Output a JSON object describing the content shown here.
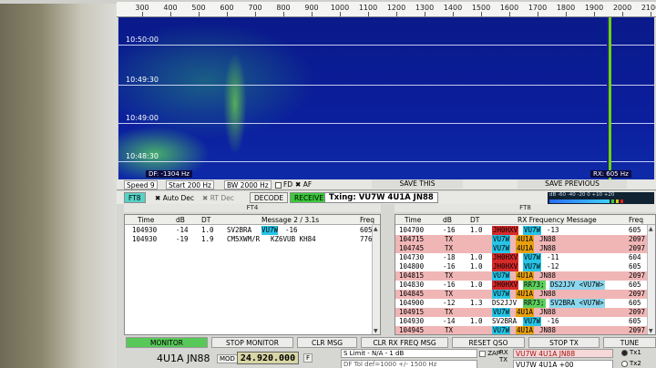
{
  "ruler": {
    "ticks": [
      "300",
      "400",
      "500",
      "600",
      "700",
      "800",
      "900",
      "1000",
      "1100",
      "1200",
      "1300",
      "1400",
      "1500",
      "1600",
      "1700",
      "1800",
      "1900",
      "2000",
      "2100"
    ]
  },
  "waterfall": {
    "times": [
      "10:50:00",
      "10:49:30",
      "10:49:00",
      "10:48:30"
    ],
    "df_label": "DF: -1304 Hz",
    "rx_label": "RX: 605 Hz"
  },
  "controls": {
    "speed": "Speed 9",
    "start": "Start 200 Hz",
    "bw": "BW 2000 Hz",
    "fd": "FD",
    "af": "AF",
    "save_this": "SAVE THIS",
    "save_previous": "SAVE PREVIOUS"
  },
  "mode": {
    "ft8": "FT8",
    "auto_dec": "Auto Dec",
    "rt_dec": "RT Dec",
    "decode": "DECODE",
    "receive": "RECEIVE",
    "txing": "Txing: VU7W 4U1A JN88",
    "meter_scale": "dB -60 -40 -20  0  +10 +20"
  },
  "left_pane": {
    "title": "FT4",
    "headers": [
      "Time",
      "dB",
      "DT",
      "Message 2 / 3.1s",
      "Freq"
    ],
    "rows": [
      {
        "time": "104930",
        "db": "-14",
        "dt": "1.0",
        "msg_a": "SV2BRA",
        "msg_call": "VU7W",
        "msg_b": "-16",
        "freq": "605"
      },
      {
        "time": "104930",
        "db": "-19",
        "dt": "1.9",
        "msg_a": "CM5XWM/R",
        "msg_call": "",
        "msg_b": "KZ6VUB KH84",
        "freq": "776"
      }
    ]
  },
  "right_pane": {
    "title": "FT8",
    "headers": [
      "Time",
      "dB",
      "DT",
      "RX Frequency Message",
      "Freq"
    ],
    "rows": [
      {
        "time": "104700",
        "db": "-16",
        "dt": "1.0",
        "tx": false,
        "parts": [
          [
            "JH0HXV",
            "red"
          ],
          [
            "VU7W",
            "blue"
          ],
          [
            "-13",
            ""
          ]
        ],
        "freq": "605"
      },
      {
        "time": "104715",
        "db": "",
        "dt": "",
        "tx": true,
        "label": "TX",
        "parts": [
          [
            "VU7W",
            "blue"
          ],
          [
            "4U1A",
            "orange"
          ],
          [
            "JN88",
            ""
          ]
        ],
        "freq": "2097"
      },
      {
        "time": "104745",
        "db": "",
        "dt": "",
        "tx": true,
        "label": "TX",
        "parts": [
          [
            "VU7W",
            "blue"
          ],
          [
            "4U1A",
            "orange"
          ],
          [
            "JN88",
            ""
          ]
        ],
        "freq": "2097"
      },
      {
        "time": "104730",
        "db": "-18",
        "dt": "1.0",
        "tx": false,
        "parts": [
          [
            "JH0HXV",
            "red"
          ],
          [
            "VU7W",
            "blue"
          ],
          [
            "-11",
            ""
          ]
        ],
        "freq": "604"
      },
      {
        "time": "104800",
        "db": "-16",
        "dt": "1.0",
        "tx": false,
        "parts": [
          [
            "JH0HXV",
            "red"
          ],
          [
            "VU7W",
            "blue"
          ],
          [
            "-12",
            ""
          ]
        ],
        "freq": "605"
      },
      {
        "time": "104815",
        "db": "",
        "dt": "",
        "tx": true,
        "label": "TX",
        "parts": [
          [
            "VU7W",
            "blue"
          ],
          [
            "4U1A",
            "orange"
          ],
          [
            "JN88",
            ""
          ]
        ],
        "freq": "2097"
      },
      {
        "time": "104830",
        "db": "-16",
        "dt": "1.0",
        "tx": false,
        "parts": [
          [
            "JH0HXV",
            "red"
          ],
          [
            "RR73;",
            "green"
          ],
          [
            "DS2JJV <VU7W>",
            "lblue"
          ]
        ],
        "freq": "605"
      },
      {
        "time": "104845",
        "db": "",
        "dt": "",
        "tx": true,
        "label": "TX",
        "parts": [
          [
            "VU7W",
            "blue"
          ],
          [
            "4U1A",
            "orange"
          ],
          [
            "JN88",
            ""
          ]
        ],
        "freq": "2097"
      },
      {
        "time": "104900",
        "db": "-12",
        "dt": "1.3",
        "tx": false,
        "parts": [
          [
            "DS2JJV",
            ""
          ],
          [
            "RR73;",
            "green"
          ],
          [
            "SV2BRA <VU7W>",
            "lblue"
          ]
        ],
        "freq": "605"
      },
      {
        "time": "104915",
        "db": "",
        "dt": "",
        "tx": true,
        "label": "TX",
        "parts": [
          [
            "VU7W",
            "blue"
          ],
          [
            "4U1A",
            "orange"
          ],
          [
            "JN88",
            ""
          ]
        ],
        "freq": "2097"
      },
      {
        "time": "104930",
        "db": "-14",
        "dt": "1.0",
        "tx": false,
        "parts": [
          [
            "SV2BRA",
            ""
          ],
          [
            "VU7W",
            "blue"
          ],
          [
            "-16",
            ""
          ]
        ],
        "freq": "605"
      },
      {
        "time": "104945",
        "db": "",
        "dt": "",
        "tx": true,
        "label": "TX",
        "parts": [
          [
            "VU7W",
            "blue"
          ],
          [
            "4U1A",
            "orange"
          ],
          [
            "JN88",
            ""
          ]
        ],
        "freq": "2097"
      }
    ]
  },
  "bottom": {
    "monitor": "MONITOR",
    "stop_monitor": "STOP MONITOR",
    "clr_msg": "CLR MSG",
    "clr_rx_freq_msg": "CLR RX FREQ MSG",
    "reset_qso": "RESET QSO",
    "stop_tx": "STOP TX",
    "tune": "TUNE",
    "callsign": "4U1A JN88",
    "mod": "MOD",
    "frequency": "24.920.000",
    "f_btn": "F",
    "s_limit": "S Limit - N/A - 1 dB",
    "df_filter": "DF Tol def=1000 +/- 1500 Hz",
    "zap": "ZAP",
    "rx_label": "RX",
    "tx_label": "TX",
    "rx_field": "VU7W 4U1A JN88",
    "tx_field": "VU7W 4U1A +00",
    "tx1": "Tx1",
    "tx2": "Tx2"
  },
  "colors": {
    "highlight_blue": "#27c4e6",
    "highlight_orange": "#e8a010",
    "highlight_red": "#d62a2a",
    "highlight_green": "#5ed05e",
    "tx_row": "#f0b6b6",
    "rx_marker": "#6ad400"
  }
}
